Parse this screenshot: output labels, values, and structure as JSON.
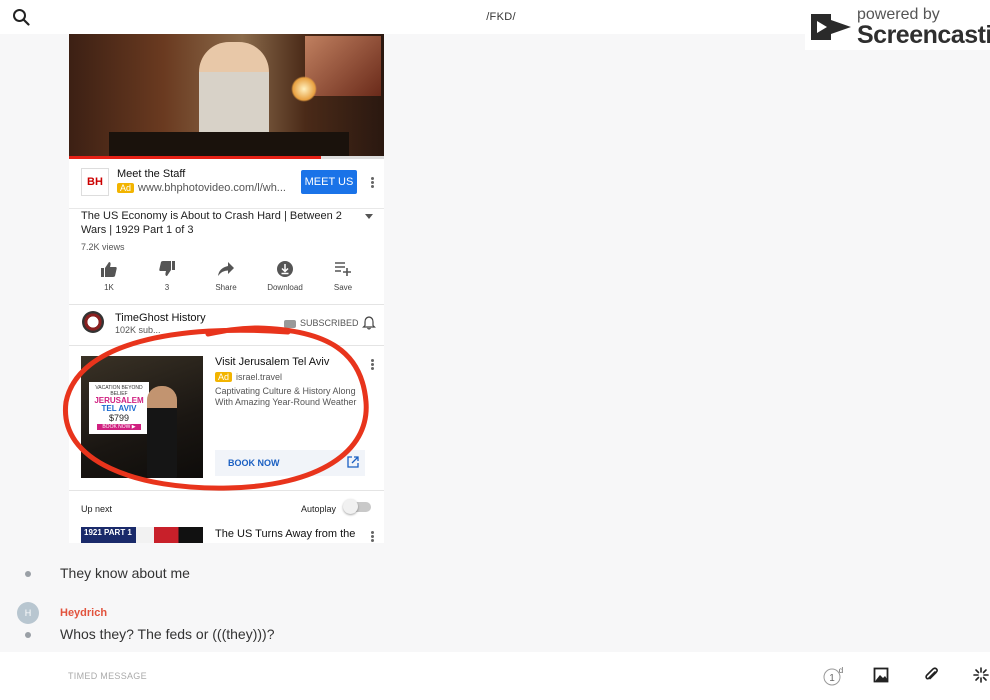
{
  "topbar": {
    "title": "/FKD/"
  },
  "watermark": {
    "line1": "powered by",
    "line2": "Screencastify"
  },
  "video": {
    "progress_percent": 80
  },
  "ad1": {
    "title": "Meet the Staff",
    "badge": "Ad",
    "url": "www.bhphotovideo.com/l/wh...",
    "button": "MEET US",
    "logo_text": "BH"
  },
  "video_info": {
    "title": "The US Economy is About to Crash Hard | Between 2 Wars | 1929 Part 1 of 3",
    "views": "7.2K views"
  },
  "actions": [
    {
      "label": "1K",
      "icon": "thumbs-up-icon"
    },
    {
      "label": "3",
      "icon": "thumbs-down-icon"
    },
    {
      "label": "Share",
      "icon": "share-icon"
    },
    {
      "label": "Download",
      "icon": "download-icon"
    },
    {
      "label": "Save",
      "icon": "playlist-add-icon"
    }
  ],
  "channel": {
    "name": "TimeGhost History",
    "subs": "102K sub...",
    "subscribed": "SUBSCRIBED"
  },
  "ad2": {
    "title": "Visit Jerusalem Tel Aviv",
    "badge": "Ad",
    "url": "israel.travel",
    "description": "Captivating Culture & History Along With Amazing Year-Round Weather",
    "button": "BOOK NOW",
    "image_text": {
      "line1": "VACATION BEYOND BELIEF",
      "line2": "JERUSALEM",
      "line3": "TEL AVIV",
      "line4": "$799",
      "line5": "BOOK NOW ▶"
    }
  },
  "upnext": {
    "label": "Up next",
    "autoplay": "Autoplay",
    "autoplay_on": false,
    "next_title": "The US Turns Away from the",
    "next_thumb_text": "1921 PART 1"
  },
  "chat": {
    "message1": "They know about me",
    "avatar_initial": "H",
    "username": "Heydrich",
    "message2": "Whos they? The feds or (((they)))?"
  },
  "composer": {
    "placeholder": "TIMED MESSAGE",
    "timer_value": "1",
    "timer_unit": "d"
  },
  "colors": {
    "accent_blue": "#1a73e8",
    "ad_yellow": "#f2b400",
    "annotation_red": "#e8341c",
    "username_red": "#e2533d"
  }
}
